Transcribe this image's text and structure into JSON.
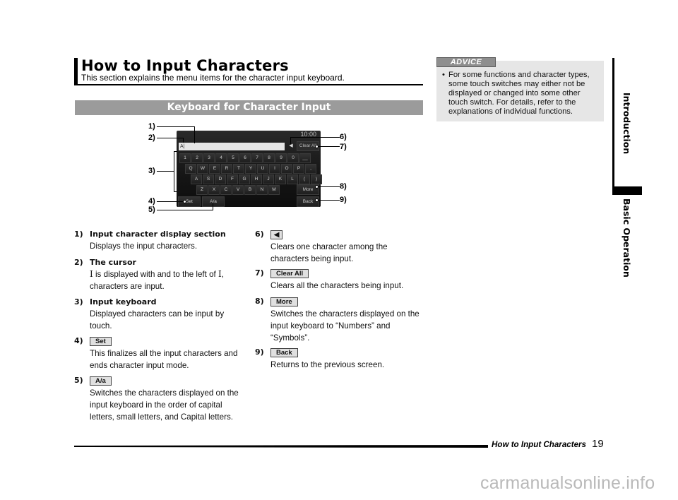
{
  "header": {
    "title": "How to Input Characters",
    "subtitle": "This section explains the menu items for the character input keyboard."
  },
  "section": {
    "title": "Keyboard for Character Input"
  },
  "advice": {
    "tag": "ADVICE",
    "bullet": "•",
    "text": "For some functions and character types, some touch switches may either not be displayed or changed into some other touch switch. For details, refer to the explanations of individual functions."
  },
  "side_tabs": {
    "introduction": "Introduction",
    "basic_operation": "Basic Operation"
  },
  "diagram": {
    "clock": "10:00",
    "input_value": "A|",
    "delete_glyph": "◀",
    "clear_label": "Clear All",
    "rows": [
      [
        "1",
        "2",
        "3",
        "4",
        "5",
        "6",
        "7",
        "8",
        "9",
        "0",
        "__"
      ],
      [
        "Q",
        "W",
        "E",
        "R",
        "T",
        "Y",
        "U",
        "I",
        "O",
        "P",
        ","
      ],
      [
        "A",
        "S",
        "D",
        "F",
        "G",
        "H",
        "J",
        "K",
        "L",
        "(",
        ")"
      ],
      [
        "Z",
        "X",
        "C",
        "V",
        "B",
        "N",
        "M"
      ]
    ],
    "more_label": "More",
    "set_label": "Set",
    "case_label": "A/a",
    "back_label": "Back",
    "callouts": [
      "1)",
      "2)",
      "3)",
      "4)",
      "5)",
      "6)",
      "7)",
      "8)",
      "9)"
    ]
  },
  "items": [
    {
      "num": "1)",
      "head": "Input character display section",
      "body": "Displays the input characters."
    },
    {
      "num": "2)",
      "head": "The cursor",
      "body_prefix": "I",
      "body": " is displayed with and to the left of ",
      "body_mid": "I",
      "body_suffix": ",",
      "body2": "characters are input."
    },
    {
      "num": "3)",
      "head": "Input keyboard",
      "body": "Displayed characters can be input by touch."
    },
    {
      "num": "4)",
      "button": "Set",
      "body": "This finalizes all the input characters and ends character input mode."
    },
    {
      "num": "5)",
      "button": "A/a",
      "body": "Switches the characters displayed on the input keyboard in the order of capital letters, small letters, and Capital letters."
    },
    {
      "num": "6)",
      "button": "◀",
      "body": "Clears one character among the characters being input."
    },
    {
      "num": "7)",
      "button": "Clear All",
      "body": "Clears all the characters being input."
    },
    {
      "num": "8)",
      "button": "More",
      "body": "Switches the characters displayed on the input keyboard to “Numbers” and “Symbols”."
    },
    {
      "num": "9)",
      "button": "Back",
      "body": "Returns to the previous screen."
    }
  ],
  "footer": {
    "title": "How to Input Characters",
    "page_number": "19",
    "watermark": "carmanualsonline.info"
  }
}
